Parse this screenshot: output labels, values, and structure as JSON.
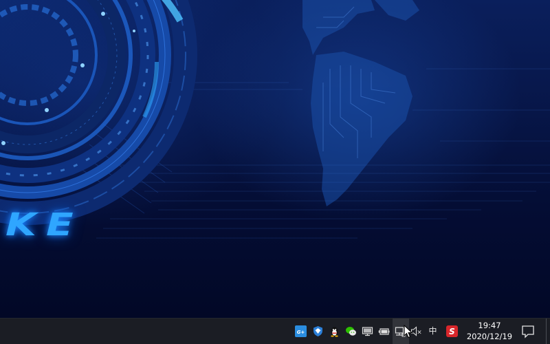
{
  "wallpaper": {
    "text": "KE",
    "colors": {
      "glow": "#2fa6ff",
      "background": "#071648"
    }
  },
  "taskbar": {
    "tray_icons": [
      {
        "name": "gplus-app-icon",
        "label": "G+"
      },
      {
        "name": "shield-security-icon",
        "label": ""
      },
      {
        "name": "qq-penguin-icon",
        "label": ""
      },
      {
        "name": "wechat-icon",
        "label": ""
      },
      {
        "name": "display-monitor-icon",
        "label": ""
      },
      {
        "name": "battery-icon",
        "label": ""
      },
      {
        "name": "network-ethernet-icon",
        "label": ""
      },
      {
        "name": "volume-muted-icon",
        "label": "×"
      }
    ],
    "ime_label": "中",
    "sogou_label": "S",
    "clock": {
      "time": "19:47",
      "date": "2020/12/19"
    },
    "colors": {
      "taskbar_bg": "#1b1d24",
      "sogou_red": "#d8262b",
      "gplus_blue": "#2a8de0"
    }
  }
}
